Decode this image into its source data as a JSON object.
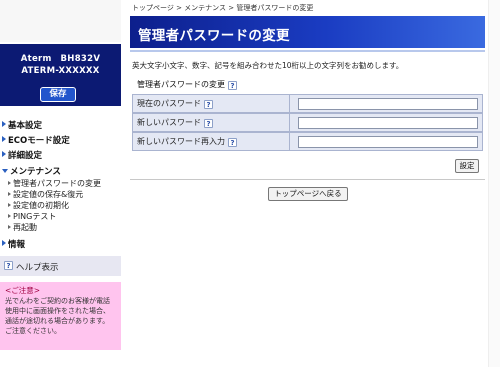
{
  "device": {
    "name": "Aterm　BH832V",
    "model": "ATERM-XXXXXX",
    "save_label": "保存"
  },
  "nav": {
    "items": [
      {
        "label": "基本設定",
        "expanded": false
      },
      {
        "label": "ECOモード設定",
        "expanded": false
      },
      {
        "label": "詳細設定",
        "expanded": false
      },
      {
        "label": "メンテナンス",
        "expanded": true
      },
      {
        "label": "情報",
        "expanded": false
      }
    ],
    "maintenance_sub": [
      "管理者パスワードの変更",
      "設定値の保存&復元",
      "設定値の初期化",
      "PINGテスト",
      "再起動"
    ]
  },
  "help": {
    "icon": "question-icon",
    "label": "ヘルプ表示"
  },
  "caution": {
    "title": "<ご注意>",
    "lines": [
      "光でんわをご契約のお客様が電話",
      "使用中に画面操作をされた場合、",
      "通話が途切れる場合があります。",
      "ご注意ください。"
    ]
  },
  "breadcrumb": "トップページ > メンテナンス > 管理者パスワードの変更",
  "page_title": "管理者パスワードの変更",
  "description": "英大文字小文字、数字、記号を組み合わせた10桁以上の文字列をお勧めします。",
  "section": {
    "title": "管理者パスワードの変更",
    "fields": [
      {
        "label": "現在のパスワード",
        "value": ""
      },
      {
        "label": "新しいパスワード",
        "value": ""
      },
      {
        "label": "新しいパスワード再入力",
        "value": ""
      }
    ]
  },
  "buttons": {
    "set_label": "設定",
    "top_label": "トップページへ戻る"
  },
  "colors": {
    "header_blue": "#0d1f8c",
    "caution_pink": "#ffc4ee",
    "save_blue": "#2255cc"
  }
}
